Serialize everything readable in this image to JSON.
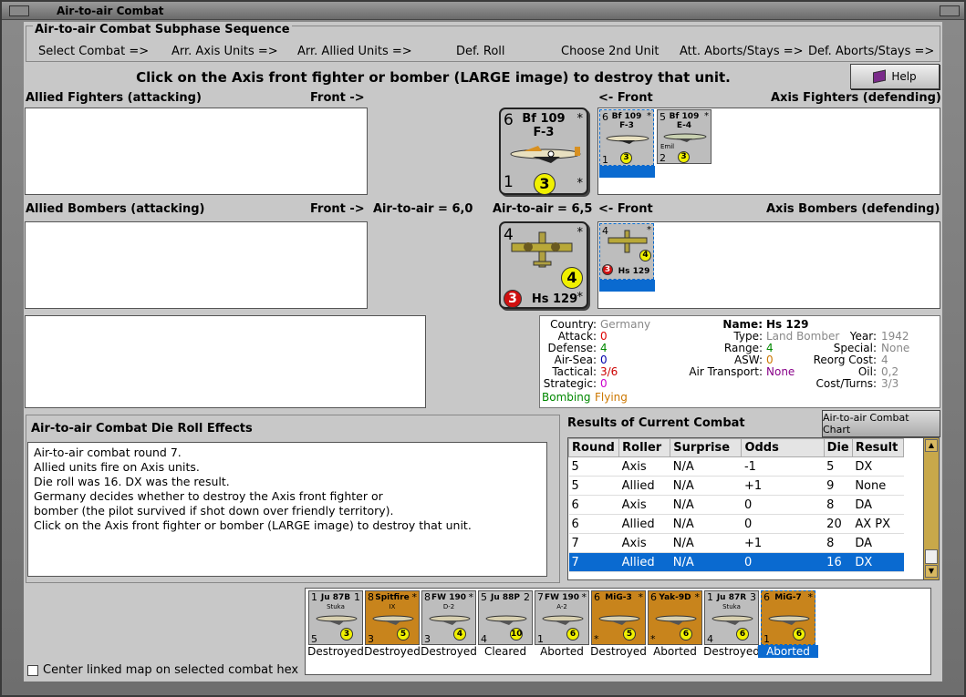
{
  "window": {
    "title": "Air-to-air Combat"
  },
  "sequence": {
    "title": "Air-to-air Combat Subphase Sequence",
    "steps": [
      "Select Combat =>",
      "Arr. Axis Units =>",
      "Arr. Allied Units =>",
      "Def. Roll",
      "Choose 2nd Unit",
      "Att. Aborts/Stays =>",
      "Def. Aborts/Stays =>"
    ]
  },
  "instruction": "Click on the Axis front fighter or bomber (LARGE image) to destroy that unit.",
  "help_label": "Help",
  "labels": {
    "allied_fighters": "Allied Fighters (attacking)",
    "front_right": "Front ->",
    "front_left": "<- Front",
    "axis_fighters": "Axis Fighters (defending)",
    "allied_bombers": "Allied Bombers (attacking)",
    "front_right2": "Front ->",
    "air_to_air_left": "Air-to-air = 6,0",
    "air_to_air_right": "Air-to-air = 6,5",
    "front_left2": "<- Front",
    "axis_bombers": "Axis Bombers (defending)"
  },
  "big_fighter": {
    "name1": "Bf 109",
    "name2": "F-3",
    "top_left": "6",
    "bottom_left": "1",
    "value": "3",
    "star": "*"
  },
  "big_bomber": {
    "name": "Hs 129",
    "top_left": "4",
    "value": "4",
    "red": "3",
    "star": "*"
  },
  "small_fighters": [
    {
      "name1": "Bf 109",
      "name2": "F-3",
      "tl": "6",
      "bl": "1",
      "val": "3",
      "star": "*"
    },
    {
      "name1": "Bf 109",
      "name2": "E-4",
      "sub": "Emil",
      "tl": "5",
      "bl": "2",
      "val": "3",
      "star": "*"
    }
  ],
  "small_bomber": {
    "name": "Hs 129",
    "tl": "4",
    "val": "4",
    "red": "3",
    "star": "*"
  },
  "info": {
    "country_label": "Country:",
    "country": "Germany",
    "attack_label": "Attack:",
    "attack": "0",
    "defense_label": "Defense:",
    "defense": "4",
    "airsea_label": "Air-Sea:",
    "airsea": "0",
    "tactical_label": "Tactical:",
    "tactical": "3/6",
    "strategic_label": "Strategic:",
    "strategic": "0",
    "bombing": "Bombing",
    "flying": "Flying",
    "name_label": "Name:",
    "name": "Hs 129",
    "type_label": "Type:",
    "type": "Land Bomber",
    "range_label": "Range:",
    "range": "4",
    "asw_label": "ASW:",
    "asw": "0",
    "transport_label": "Air Transport:",
    "transport": "None",
    "year_label": "Year:",
    "year": "1942",
    "special_label": "Special:",
    "special": "None",
    "reorg_label": "Reorg Cost:",
    "reorg": "4",
    "oil_label": "Oil:",
    "oil": "0,2",
    "cost_label": "Cost/Turns:",
    "cost": "3/3"
  },
  "die": {
    "title": "Air-to-air Combat Die Roll Effects",
    "lines": [
      "Air-to-air combat round 7.",
      "Allied units fire on Axis units.",
      "Die roll was 16.  DX was the result.",
      "Germany decides whether to destroy the Axis front fighter or",
      "bomber (the pilot survived if shot down over friendly territory).",
      "Click on the Axis front fighter or bomber (LARGE image) to destroy that unit."
    ]
  },
  "results": {
    "title": "Results of Current Combat",
    "chart_button": "Air-to-air Combat Chart",
    "headers": [
      "Round",
      "Roller",
      "Surprise",
      "Odds",
      "Die",
      "Result"
    ],
    "rows": [
      [
        "5",
        "Axis",
        "N/A",
        "-1",
        "5",
        "DX"
      ],
      [
        "5",
        "Allied",
        "N/A",
        "+1",
        "9",
        "None"
      ],
      [
        "6",
        "Axis",
        "N/A",
        "0",
        "8",
        "DA"
      ],
      [
        "6",
        "Allied",
        "N/A",
        "0",
        "20",
        "AX PX"
      ],
      [
        "7",
        "Axis",
        "N/A",
        "+1",
        "8",
        "DA"
      ],
      [
        "7",
        "Allied",
        "N/A",
        "0",
        "16",
        "DX"
      ]
    ]
  },
  "bottom_units": [
    {
      "name": "Ju 87B",
      "sub": "Stuka",
      "tl": "1",
      "bl": "5",
      "tr": "1",
      "val": "3",
      "status": "Destroyed",
      "bg": "#bdbdbd"
    },
    {
      "name": "Spitfire",
      "sub": "IX",
      "tl": "8",
      "bl": "3",
      "tr": "*",
      "val": "5",
      "status": "Destroyed",
      "bg": "#c8841c"
    },
    {
      "name": "FW 190",
      "sub": "D-2",
      "tl": "8",
      "bl": "3",
      "tr": "*",
      "val": "4",
      "status": "Destroyed",
      "bg": "#bdbdbd"
    },
    {
      "name": "Ju 88P",
      "sub": "",
      "tl": "5",
      "bl": "4",
      "tr": "2",
      "val": "10",
      "status": "Cleared",
      "bg": "#bdbdbd"
    },
    {
      "name": "FW 190",
      "sub": "A-2",
      "tl": "7",
      "bl": "1",
      "tr": "*",
      "val": "6",
      "status": "Aborted",
      "bg": "#bdbdbd"
    },
    {
      "name": "MiG-3",
      "sub": "",
      "tl": "6",
      "bl": "*",
      "tr": "*",
      "val": "5",
      "status": "Destroyed",
      "bg": "#c8841c"
    },
    {
      "name": "Yak-9D",
      "sub": "",
      "tl": "6",
      "bl": "*",
      "tr": "*",
      "val": "6",
      "status": "Aborted",
      "bg": "#c8841c"
    },
    {
      "name": "Ju 87R",
      "sub": "Stuka",
      "tl": "1",
      "bl": "4",
      "tr": "3",
      "val": "6",
      "status": "Destroyed",
      "bg": "#bdbdbd"
    },
    {
      "name": "MiG-7",
      "sub": "",
      "tl": "6",
      "bl": "1",
      "tr": "*",
      "val": "6",
      "status": "Aborted",
      "bg": "#c8841c"
    }
  ],
  "center_map_label": "Center linked map on selected combat hex"
}
